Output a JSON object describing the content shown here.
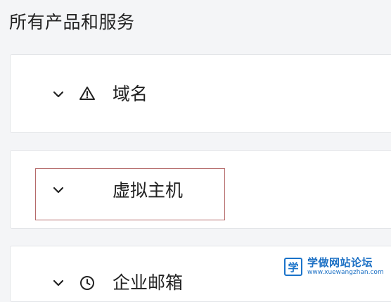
{
  "header": {
    "title": "所有产品和服务"
  },
  "products": [
    {
      "label": "域名",
      "icon": "warning-icon",
      "expanded": false
    },
    {
      "label": "虚拟主机",
      "icon": "",
      "expanded": false,
      "focused": true
    },
    {
      "label": "企业邮箱",
      "icon": "clock-icon",
      "expanded": false
    }
  ],
  "watermark": {
    "logo_glyph": "学",
    "name": "学做网站论坛",
    "url": "www.xuewangzhan.com"
  },
  "colors": {
    "background": "#f4f5f7",
    "card": "#ffffff",
    "focus_outline": "#b56a6a",
    "watermark_blue": "#1a6fc4"
  }
}
